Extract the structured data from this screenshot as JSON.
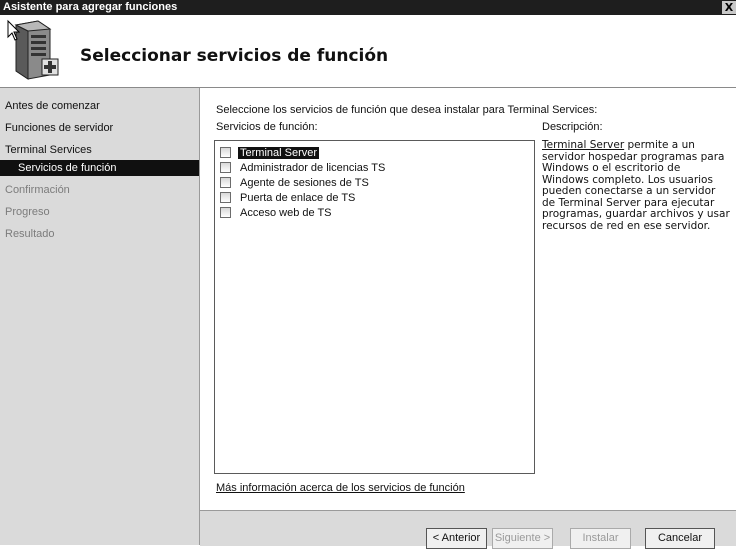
{
  "window": {
    "title": "Asistente para agregar funciones",
    "close_label": "X"
  },
  "header": {
    "title": "Seleccionar servicios de función"
  },
  "sidebar": {
    "items": [
      {
        "label": "Antes de comenzar"
      },
      {
        "label": "Funciones de servidor"
      },
      {
        "label": "Terminal Services"
      },
      {
        "label": "Servicios de función"
      },
      {
        "label": "Confirmación"
      },
      {
        "label": "Progreso"
      },
      {
        "label": "Resultado"
      }
    ]
  },
  "main": {
    "intro": "Seleccione los servicios de función que desea instalar para Terminal Services:",
    "services_label": "Servicios de función:",
    "description_label": "Descripción:",
    "services": [
      {
        "label": "Terminal Server",
        "checked": false,
        "selected": true
      },
      {
        "label": "Administrador de licencias TS",
        "checked": false
      },
      {
        "label": "Agente de sesiones de TS",
        "checked": false
      },
      {
        "label": "Puerta de enlace de TS",
        "checked": false
      },
      {
        "label": "Acceso web de TS",
        "checked": false
      }
    ],
    "description_link": "Terminal Server",
    "description_text": " permite a un servidor hospedar programas para Windows o el escritorio de Windows completo. Los usuarios pueden conectarse a un servidor de Terminal Server para ejecutar programas, guardar archivos y usar recursos de red en ese servidor.",
    "more_info": "Más información acerca de los servicios de función"
  },
  "footer": {
    "back": "< Anterior",
    "next": "Siguiente >",
    "install": "Instalar",
    "cancel": "Cancelar"
  }
}
